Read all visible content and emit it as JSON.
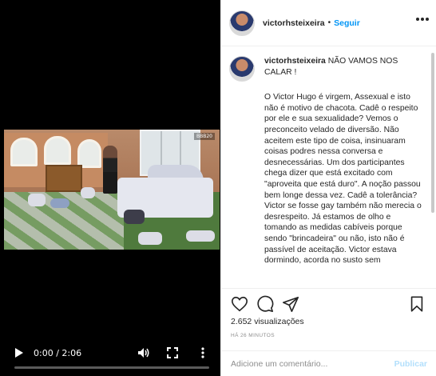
{
  "video": {
    "time": "0:00 / 2:06",
    "progress": 0,
    "overlay_logo": "BBB20"
  },
  "header": {
    "username": "victorhsteixeira",
    "separator": "•",
    "follow_label": "Seguir"
  },
  "caption": {
    "username": "victorhsteixeira",
    "text": "NÃO VAMOS NOS CALAR !",
    "body": "O Victor Hugo é virgem, Assexual e isto não é motivo de chacota. Cadê o respeito por ele e sua sexualidade? Vemos o preconceito velado de diversão. Não aceitem este tipo de coisa, insinuaram coisas podres nessa conversa e desnecessárias. Um dos participantes chega dizer que está excitado com \"aproveita que está duro\". A noção passou bem longe dessa vez. Cadê a tolerância? Victor se fosse gay também não merecia o desrespeito. Já estamos de olho e tomando as medidas cabíveis porque sendo \"brincadeira\" ou não, isto não é passível de aceitação. Victor estava dormindo, acorda no susto sem"
  },
  "stats": {
    "views": "2.652 visualizações",
    "timestamp": "HÁ 26 MINUTOS"
  },
  "comment_box": {
    "placeholder": "Adicione um comentário...",
    "publish_label": "Publicar"
  },
  "colors": {
    "accent": "#0095f6",
    "publish_disabled": "#b2dffc",
    "muted": "#8e8e8e",
    "text": "#262626"
  },
  "icons": [
    "play-icon",
    "volume-icon",
    "fullscreen-icon",
    "more-vertical-icon",
    "heart-icon",
    "comment-icon",
    "share-icon",
    "bookmark-icon",
    "more-horizontal-icon"
  ]
}
